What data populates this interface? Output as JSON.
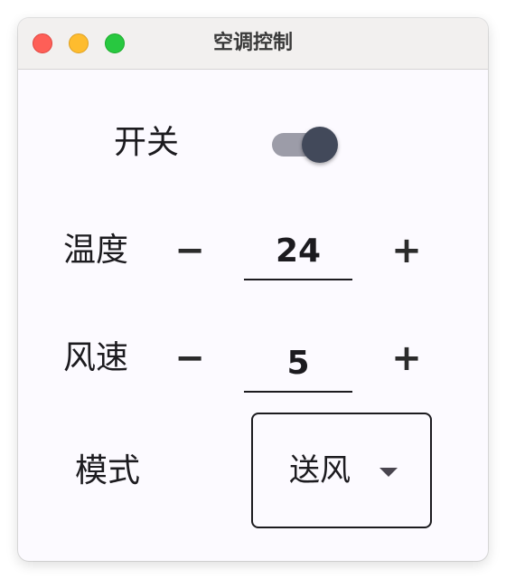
{
  "window": {
    "title": "空调控制",
    "buttons": [
      "close",
      "minimize",
      "maximize"
    ]
  },
  "power": {
    "label": "开关",
    "on": true
  },
  "temperature": {
    "label": "温度",
    "minus": "−",
    "value": "24",
    "plus": "+"
  },
  "fan_speed": {
    "label": "风速",
    "minus": "−",
    "value": "5",
    "plus": "+"
  },
  "mode": {
    "label": "模式",
    "selected": "送风"
  },
  "colors": {
    "window_bg": "#fcfaff",
    "titlebar_bg": "#f2f0ef",
    "switch_track": "#9c9ca8",
    "switch_thumb": "#42495a",
    "close": "#fe5f57",
    "minimize": "#febc2e",
    "maximize": "#28c840"
  }
}
